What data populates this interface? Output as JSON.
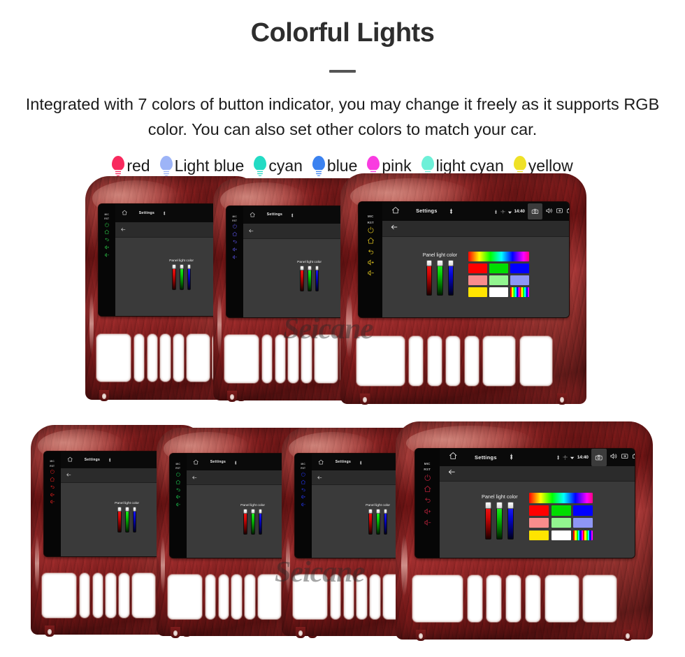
{
  "header": {
    "title": "Colorful Lights",
    "subtitle": "Integrated with 7 colors of button indicator, you may change it freely as it supports RGB color. You can also set other colors to match your car."
  },
  "legend": {
    "items": [
      {
        "label": "red",
        "color": "#f82a5e"
      },
      {
        "label": "Light blue",
        "color": "#9db4f7"
      },
      {
        "label": "cyan",
        "color": "#23dbc4"
      },
      {
        "label": "blue",
        "color": "#3b82f0"
      },
      {
        "label": "pink",
        "color": "#f93ce0"
      },
      {
        "label": "light cyan",
        "color": "#6ef0d8"
      },
      {
        "label": "yellow",
        "color": "#efe127"
      }
    ]
  },
  "screen_ui": {
    "mic_label": "MIC",
    "reset_label": "RST",
    "app_title": "Settings",
    "clock": "14:40",
    "panel_label": "Panel light color",
    "sliders": [
      {
        "name": "red-channel",
        "value": 100
      },
      {
        "name": "green-channel",
        "value": 100
      },
      {
        "name": "blue-channel",
        "value": 100
      }
    ],
    "status_icons": [
      "bluetooth-icon",
      "location-icon",
      "wifi-icon",
      "camera-icon",
      "volume-icon",
      "screenshot-icon",
      "recents-icon",
      "back-arrow-icon"
    ],
    "key_icons": [
      "power-icon",
      "home-icon",
      "return-icon",
      "volume-up-icon",
      "volume-down-icon"
    ],
    "nav_back_icon": "back-arrow-icon",
    "swatch_grid": {
      "hue_bar": "hue-gradient",
      "rows": [
        [
          "#ff0000",
          "#00dd00",
          "#0000ff"
        ],
        [
          "#f98c8c",
          "#92f58f",
          "#8e96f5"
        ],
        [
          "#ffe400",
          "#ffffff",
          "rainbow"
        ]
      ]
    }
  },
  "units": {
    "watermark": "Seicane",
    "top_row": [
      {
        "name": "unit-top-1",
        "key_color": "#2ecf4a",
        "screen_mode": "sliders"
      },
      {
        "name": "unit-top-2",
        "key_color": "#5f57f0",
        "screen_mode": "sliders"
      },
      {
        "name": "unit-top-3",
        "key_color": "#e0c41e",
        "screen_mode": "full"
      }
    ],
    "bottom_row": [
      {
        "name": "unit-bottom-1",
        "key_color": "#e8201f",
        "screen_mode": "sliders"
      },
      {
        "name": "unit-bottom-2",
        "key_color": "#1ecb52",
        "screen_mode": "sliders"
      },
      {
        "name": "unit-bottom-3",
        "key_color": "#2536f2",
        "screen_mode": "sliders"
      },
      {
        "name": "unit-bottom-4",
        "key_color": "#b8213a",
        "screen_mode": "full"
      }
    ]
  }
}
